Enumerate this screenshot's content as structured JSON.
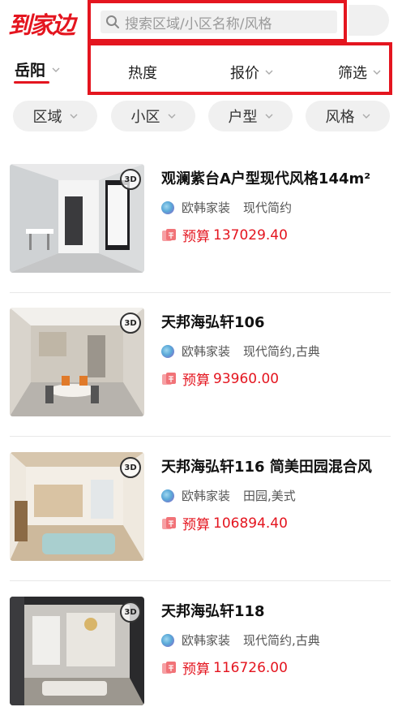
{
  "brand": {
    "logo_text": "到家边"
  },
  "search": {
    "placeholder": "搜索区域/小区名称/风格"
  },
  "city": {
    "label": "岳阳"
  },
  "sort_bar": {
    "items": [
      "热度",
      "报价",
      "筛选"
    ]
  },
  "filters": {
    "items": [
      "区域",
      "小区",
      "户型",
      "风格"
    ]
  },
  "listings": [
    {
      "title": "观澜紫台A户型现代风格144m²",
      "company": "欧韩家装",
      "style": "现代简约",
      "budget_label": "预算",
      "budget": "137029.40",
      "badge": "3D"
    },
    {
      "title": "天邦海弘轩106",
      "company": "欧韩家装",
      "style": "现代简约,古典",
      "budget_label": "预算",
      "budget": "93960.00",
      "badge": "3D"
    },
    {
      "title": "天邦海弘轩116 简美田园混合风",
      "company": "欧韩家装",
      "style": "田园,美式",
      "budget_label": "预算",
      "budget": "106894.40",
      "badge": "3D"
    },
    {
      "title": "天邦海弘轩118",
      "company": "欧韩家装",
      "style": "现代简约,古典",
      "budget_label": "预算",
      "budget": "116726.00",
      "badge": "3D"
    }
  ],
  "colors": {
    "accent": "#e4151f",
    "pill_bg": "#f0f0f0",
    "price": "#e4151f"
  },
  "icons": {
    "search": "search-icon",
    "chevron": "chevron-down-icon",
    "badge": "3d-view-icon",
    "budget": "budget-icon"
  }
}
